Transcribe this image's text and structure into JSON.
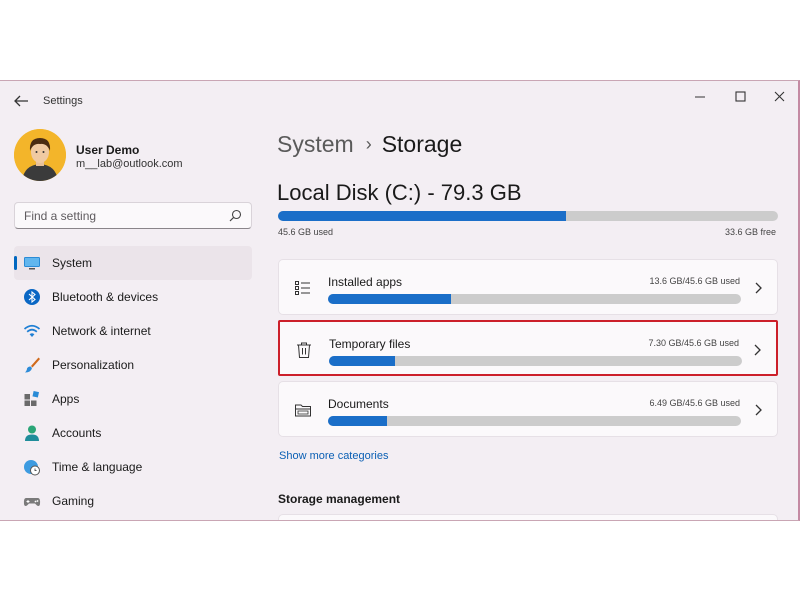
{
  "window": {
    "title": "Settings"
  },
  "user": {
    "name": "User Demo",
    "email": "m__lab@outlook.com"
  },
  "search": {
    "placeholder": "Find a setting",
    "value": ""
  },
  "sidebar": {
    "items": [
      {
        "label": "System",
        "icon": "monitor-icon",
        "active": true
      },
      {
        "label": "Bluetooth & devices",
        "icon": "bluetooth-icon"
      },
      {
        "label": "Network & internet",
        "icon": "wifi-icon"
      },
      {
        "label": "Personalization",
        "icon": "brush-icon"
      },
      {
        "label": "Apps",
        "icon": "apps-icon"
      },
      {
        "label": "Accounts",
        "icon": "person-icon"
      },
      {
        "label": "Time & language",
        "icon": "globe-clock-icon"
      },
      {
        "label": "Gaming",
        "icon": "gamepad-icon"
      }
    ]
  },
  "breadcrumb": {
    "parent": "System",
    "separator": "›",
    "current": "Storage"
  },
  "disk": {
    "title": "Local Disk (C:) - 79.3 GB",
    "used_label": "45.6 GB used",
    "free_label": "33.6 GB free",
    "used_fraction": 0.575
  },
  "categories": [
    {
      "label": "Installed apps",
      "size": "13.6 GB/45.6 GB used",
      "fraction": 0.298,
      "icon": "list-icon",
      "highlighted": false
    },
    {
      "label": "Temporary files",
      "size": "7.30 GB/45.6 GB used",
      "fraction": 0.16,
      "icon": "trash-icon",
      "highlighted": true
    },
    {
      "label": "Documents",
      "size": "6.49 GB/45.6 GB used",
      "fraction": 0.142,
      "icon": "folder-icon",
      "highlighted": false
    }
  ],
  "show_more": "Show more categories",
  "storage_management": {
    "heading": "Storage management"
  },
  "colors": {
    "accent": "#1a6ec8",
    "highlight": "#cc1f2a",
    "track": "#cccccc"
  }
}
